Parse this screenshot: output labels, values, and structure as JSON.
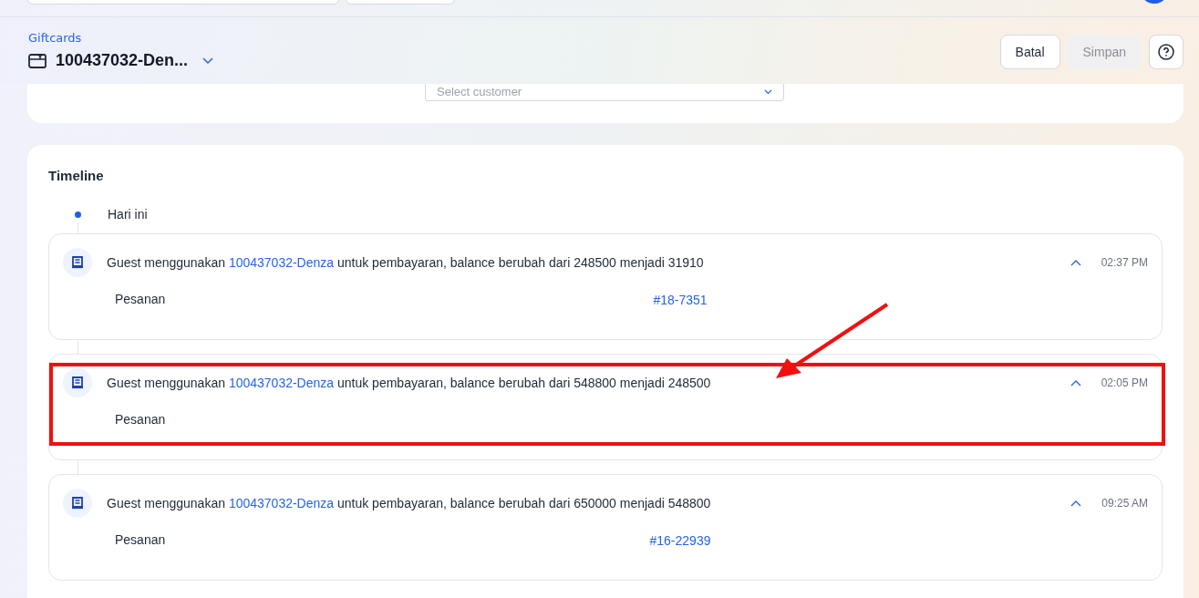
{
  "header": {
    "breadcrumb": "Giftcards",
    "title": "100437032-Den...",
    "buttons": [
      {
        "label": "Batal",
        "disabled": false
      },
      {
        "label": "Simpan",
        "disabled": true
      }
    ]
  },
  "customer_select": {
    "placeholder": "Select customer"
  },
  "timeline": {
    "title": "Timeline",
    "day": "Hari ini",
    "entries": [
      {
        "before": "Guest menggunakan ",
        "link": "100437032-Denza",
        "after": " untuk pembayaran, balance berubah dari 248500 menjadi 31910",
        "time": "02:37 PM",
        "expanded": true,
        "order_label": "Pesanan",
        "order_link": "#18-7351",
        "highlighted": false
      },
      {
        "before": "Guest menggunakan ",
        "link": "100437032-Denza",
        "after": " untuk pembayaran, balance berubah dari 548800 menjadi 248500",
        "time": "02:05 PM",
        "expanded": true,
        "order_label": "Pesanan",
        "highlighted": true
      },
      {
        "before": "Guest menggunakan ",
        "link": "100437032-Denza",
        "after": " untuk pembayaran, balance berubah dari 650000 menjadi 548800",
        "time": "09:25 AM",
        "expanded": true,
        "order_label": "Pesanan",
        "order_link": "#16-22939",
        "highlighted": false
      }
    ]
  }
}
